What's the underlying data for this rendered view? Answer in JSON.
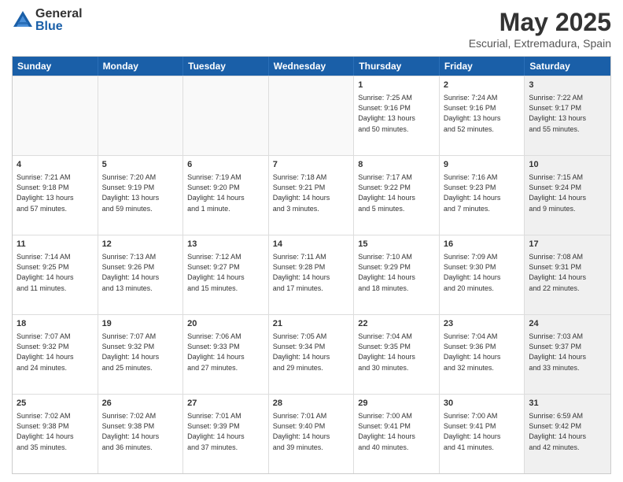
{
  "logo": {
    "general": "General",
    "blue": "Blue"
  },
  "title": "May 2025",
  "subtitle": "Escurial, Extremadura, Spain",
  "header_days": [
    "Sunday",
    "Monday",
    "Tuesday",
    "Wednesday",
    "Thursday",
    "Friday",
    "Saturday"
  ],
  "rows": [
    [
      {
        "day": "",
        "shaded": true,
        "lines": []
      },
      {
        "day": "",
        "shaded": true,
        "lines": []
      },
      {
        "day": "",
        "shaded": true,
        "lines": []
      },
      {
        "day": "",
        "shaded": true,
        "lines": []
      },
      {
        "day": "1",
        "shaded": false,
        "lines": [
          "Sunrise: 7:25 AM",
          "Sunset: 9:16 PM",
          "Daylight: 13 hours",
          "and 50 minutes."
        ]
      },
      {
        "day": "2",
        "shaded": false,
        "lines": [
          "Sunrise: 7:24 AM",
          "Sunset: 9:16 PM",
          "Daylight: 13 hours",
          "and 52 minutes."
        ]
      },
      {
        "day": "3",
        "shaded": true,
        "lines": [
          "Sunrise: 7:22 AM",
          "Sunset: 9:17 PM",
          "Daylight: 13 hours",
          "and 55 minutes."
        ]
      }
    ],
    [
      {
        "day": "4",
        "shaded": false,
        "lines": [
          "Sunrise: 7:21 AM",
          "Sunset: 9:18 PM",
          "Daylight: 13 hours",
          "and 57 minutes."
        ]
      },
      {
        "day": "5",
        "shaded": false,
        "lines": [
          "Sunrise: 7:20 AM",
          "Sunset: 9:19 PM",
          "Daylight: 13 hours",
          "and 59 minutes."
        ]
      },
      {
        "day": "6",
        "shaded": false,
        "lines": [
          "Sunrise: 7:19 AM",
          "Sunset: 9:20 PM",
          "Daylight: 14 hours",
          "and 1 minute."
        ]
      },
      {
        "day": "7",
        "shaded": false,
        "lines": [
          "Sunrise: 7:18 AM",
          "Sunset: 9:21 PM",
          "Daylight: 14 hours",
          "and 3 minutes."
        ]
      },
      {
        "day": "8",
        "shaded": false,
        "lines": [
          "Sunrise: 7:17 AM",
          "Sunset: 9:22 PM",
          "Daylight: 14 hours",
          "and 5 minutes."
        ]
      },
      {
        "day": "9",
        "shaded": false,
        "lines": [
          "Sunrise: 7:16 AM",
          "Sunset: 9:23 PM",
          "Daylight: 14 hours",
          "and 7 minutes."
        ]
      },
      {
        "day": "10",
        "shaded": true,
        "lines": [
          "Sunrise: 7:15 AM",
          "Sunset: 9:24 PM",
          "Daylight: 14 hours",
          "and 9 minutes."
        ]
      }
    ],
    [
      {
        "day": "11",
        "shaded": false,
        "lines": [
          "Sunrise: 7:14 AM",
          "Sunset: 9:25 PM",
          "Daylight: 14 hours",
          "and 11 minutes."
        ]
      },
      {
        "day": "12",
        "shaded": false,
        "lines": [
          "Sunrise: 7:13 AM",
          "Sunset: 9:26 PM",
          "Daylight: 14 hours",
          "and 13 minutes."
        ]
      },
      {
        "day": "13",
        "shaded": false,
        "lines": [
          "Sunrise: 7:12 AM",
          "Sunset: 9:27 PM",
          "Daylight: 14 hours",
          "and 15 minutes."
        ]
      },
      {
        "day": "14",
        "shaded": false,
        "lines": [
          "Sunrise: 7:11 AM",
          "Sunset: 9:28 PM",
          "Daylight: 14 hours",
          "and 17 minutes."
        ]
      },
      {
        "day": "15",
        "shaded": false,
        "lines": [
          "Sunrise: 7:10 AM",
          "Sunset: 9:29 PM",
          "Daylight: 14 hours",
          "and 18 minutes."
        ]
      },
      {
        "day": "16",
        "shaded": false,
        "lines": [
          "Sunrise: 7:09 AM",
          "Sunset: 9:30 PM",
          "Daylight: 14 hours",
          "and 20 minutes."
        ]
      },
      {
        "day": "17",
        "shaded": true,
        "lines": [
          "Sunrise: 7:08 AM",
          "Sunset: 9:31 PM",
          "Daylight: 14 hours",
          "and 22 minutes."
        ]
      }
    ],
    [
      {
        "day": "18",
        "shaded": false,
        "lines": [
          "Sunrise: 7:07 AM",
          "Sunset: 9:32 PM",
          "Daylight: 14 hours",
          "and 24 minutes."
        ]
      },
      {
        "day": "19",
        "shaded": false,
        "lines": [
          "Sunrise: 7:07 AM",
          "Sunset: 9:32 PM",
          "Daylight: 14 hours",
          "and 25 minutes."
        ]
      },
      {
        "day": "20",
        "shaded": false,
        "lines": [
          "Sunrise: 7:06 AM",
          "Sunset: 9:33 PM",
          "Daylight: 14 hours",
          "and 27 minutes."
        ]
      },
      {
        "day": "21",
        "shaded": false,
        "lines": [
          "Sunrise: 7:05 AM",
          "Sunset: 9:34 PM",
          "Daylight: 14 hours",
          "and 29 minutes."
        ]
      },
      {
        "day": "22",
        "shaded": false,
        "lines": [
          "Sunrise: 7:04 AM",
          "Sunset: 9:35 PM",
          "Daylight: 14 hours",
          "and 30 minutes."
        ]
      },
      {
        "day": "23",
        "shaded": false,
        "lines": [
          "Sunrise: 7:04 AM",
          "Sunset: 9:36 PM",
          "Daylight: 14 hours",
          "and 32 minutes."
        ]
      },
      {
        "day": "24",
        "shaded": true,
        "lines": [
          "Sunrise: 7:03 AM",
          "Sunset: 9:37 PM",
          "Daylight: 14 hours",
          "and 33 minutes."
        ]
      }
    ],
    [
      {
        "day": "25",
        "shaded": false,
        "lines": [
          "Sunrise: 7:02 AM",
          "Sunset: 9:38 PM",
          "Daylight: 14 hours",
          "and 35 minutes."
        ]
      },
      {
        "day": "26",
        "shaded": false,
        "lines": [
          "Sunrise: 7:02 AM",
          "Sunset: 9:38 PM",
          "Daylight: 14 hours",
          "and 36 minutes."
        ]
      },
      {
        "day": "27",
        "shaded": false,
        "lines": [
          "Sunrise: 7:01 AM",
          "Sunset: 9:39 PM",
          "Daylight: 14 hours",
          "and 37 minutes."
        ]
      },
      {
        "day": "28",
        "shaded": false,
        "lines": [
          "Sunrise: 7:01 AM",
          "Sunset: 9:40 PM",
          "Daylight: 14 hours",
          "and 39 minutes."
        ]
      },
      {
        "day": "29",
        "shaded": false,
        "lines": [
          "Sunrise: 7:00 AM",
          "Sunset: 9:41 PM",
          "Daylight: 14 hours",
          "and 40 minutes."
        ]
      },
      {
        "day": "30",
        "shaded": false,
        "lines": [
          "Sunrise: 7:00 AM",
          "Sunset: 9:41 PM",
          "Daylight: 14 hours",
          "and 41 minutes."
        ]
      },
      {
        "day": "31",
        "shaded": true,
        "lines": [
          "Sunrise: 6:59 AM",
          "Sunset: 9:42 PM",
          "Daylight: 14 hours",
          "and 42 minutes."
        ]
      }
    ]
  ]
}
